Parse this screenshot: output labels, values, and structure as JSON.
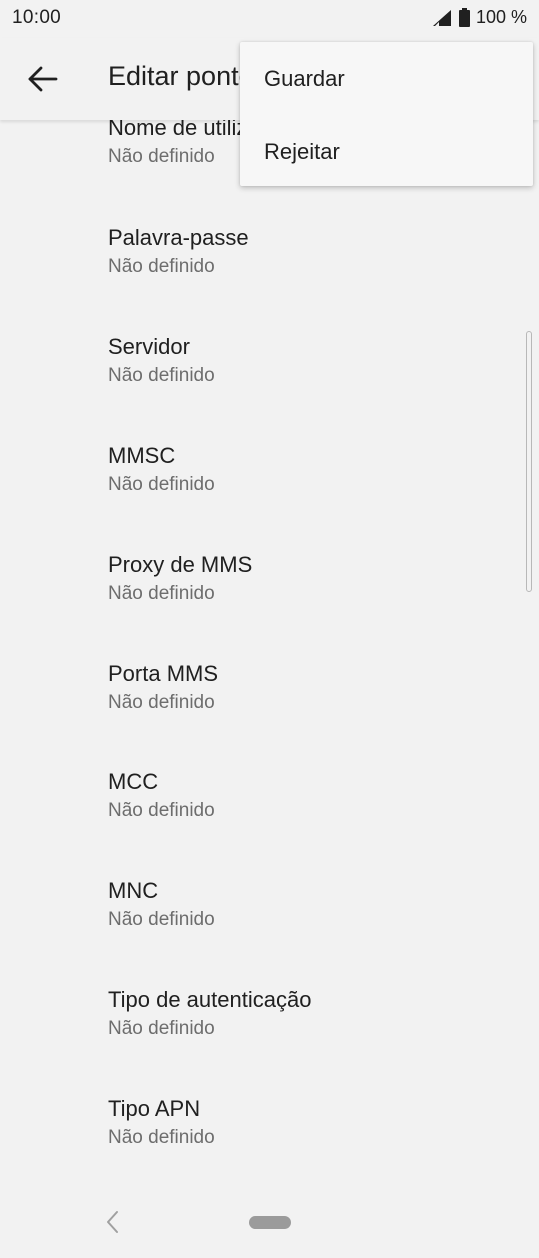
{
  "status_bar": {
    "time": "10:00",
    "battery": "100 %",
    "icons": [
      "signal-icon",
      "battery-icon"
    ]
  },
  "app_bar": {
    "back_icon": "arrow-back-icon",
    "title": "Editar ponto de acesso"
  },
  "menu": {
    "items": [
      {
        "label": "Guardar"
      },
      {
        "label": "Rejeitar"
      }
    ]
  },
  "settings": [
    {
      "title": "Nome de utilizador",
      "value": "Não definido"
    },
    {
      "title": "Palavra-passe",
      "value": "Não definido"
    },
    {
      "title": "Servidor",
      "value": "Não definido"
    },
    {
      "title": "MMSC",
      "value": "Não definido"
    },
    {
      "title": "Proxy de MMS",
      "value": "Não definido"
    },
    {
      "title": "Porta MMS",
      "value": "Não definido"
    },
    {
      "title": "MCC",
      "value": "Não definido"
    },
    {
      "title": "MNC",
      "value": "Não definido"
    },
    {
      "title": "Tipo de autenticação",
      "value": "Não definido"
    },
    {
      "title": "Tipo APN",
      "value": "Não definido"
    }
  ],
  "nav_bar": {
    "icons": [
      "nav-back-icon",
      "home-pill"
    ]
  },
  "colors": {
    "background": "#f2f2f2",
    "menu_background": "#f7f7f7",
    "primary_text": "#202020",
    "secondary_text": "#6d6d6d"
  }
}
